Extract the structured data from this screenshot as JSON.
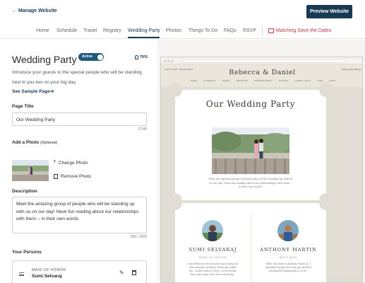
{
  "topbar": {
    "manage_link": "← Manage Website",
    "preview_button": "Preview Website"
  },
  "nav": {
    "tabs": [
      "Home",
      "Schedule",
      "Travel",
      "Registry",
      "Wedding Party",
      "Photos",
      "Things To Do",
      "FAQs",
      "RSVP"
    ],
    "active_tab": "Wedding Party",
    "save_the_dates": "Matching Save the Dates"
  },
  "editor": {
    "title": "Wedding Party",
    "status": "Active",
    "tips": "TIPS",
    "intro": "Introduce your guests to the special people who will be standing next to you two on your big day.",
    "sample_link": "See Sample Page",
    "page_title_label": "Page Title",
    "page_title_value": "Our Wedding Party",
    "page_title_counter": "17/40",
    "photo_label": "Add a Photo",
    "photo_optional": "(Optional)",
    "change_photo": "Change Photo",
    "remove_photo": "Remove Photo",
    "description_label": "Description",
    "description_value": "Meet the amazing group of people who will be standing up with us on our day! Have fun reading about our relationships with them -- in their own words.",
    "description_counter": "150 / 1000",
    "persons_label": "Your Persons",
    "persons": [
      {
        "role": "MAID OF HONOR",
        "name": "Sumi Selvaraj"
      }
    ]
  },
  "preview": {
    "header_left": "April 12, 2025",
    "header_left2": "Sanibel Island",
    "header_right": "#RebeccaAndDaniel",
    "couple": "Rebecca & Daniel",
    "site_nav": [
      "HOME",
      "SCHEDULE",
      "TRAVEL",
      "REGISTRY",
      "WEDDING PARTY",
      "PHOTOS",
      "THINGS TO DO",
      "FAQS",
      "RSVP"
    ],
    "page_title": "Our Wedding Party",
    "caption": "Meet the amazing group of people who will be standing up with us on our day! Have fun reading about our relationships with them -- in their own words.",
    "persons": [
      {
        "name": "SUMI SELVARAJ",
        "role": "MAID OF HONOR",
        "bio": "I met Rebecca over ten years ago during our first semester at Emory. When she asked her... at the Darlow's crew... to be friends. Ever since then, she's been one of my..."
      },
      {
        "name": "ANTHONY MARTIN",
        "role": "BEST MAN",
        "bio": "Hello! My name is Anthony Martin, Jr. I attended Georgia Tech and got my BS in Mechanical Engineering in 2014..."
      }
    ]
  },
  "colors": {
    "primary": "#173a52",
    "accent": "#c0394b",
    "toggle": "#1f5a7a",
    "preview_bg": "#e2ddd4"
  },
  "icons": [
    "arrow-left-icon",
    "envelope-icon",
    "lightbulb-icon",
    "arrow-right-icon",
    "upload-icon",
    "trash-icon",
    "drag-handle-icon",
    "pencil-icon"
  ]
}
